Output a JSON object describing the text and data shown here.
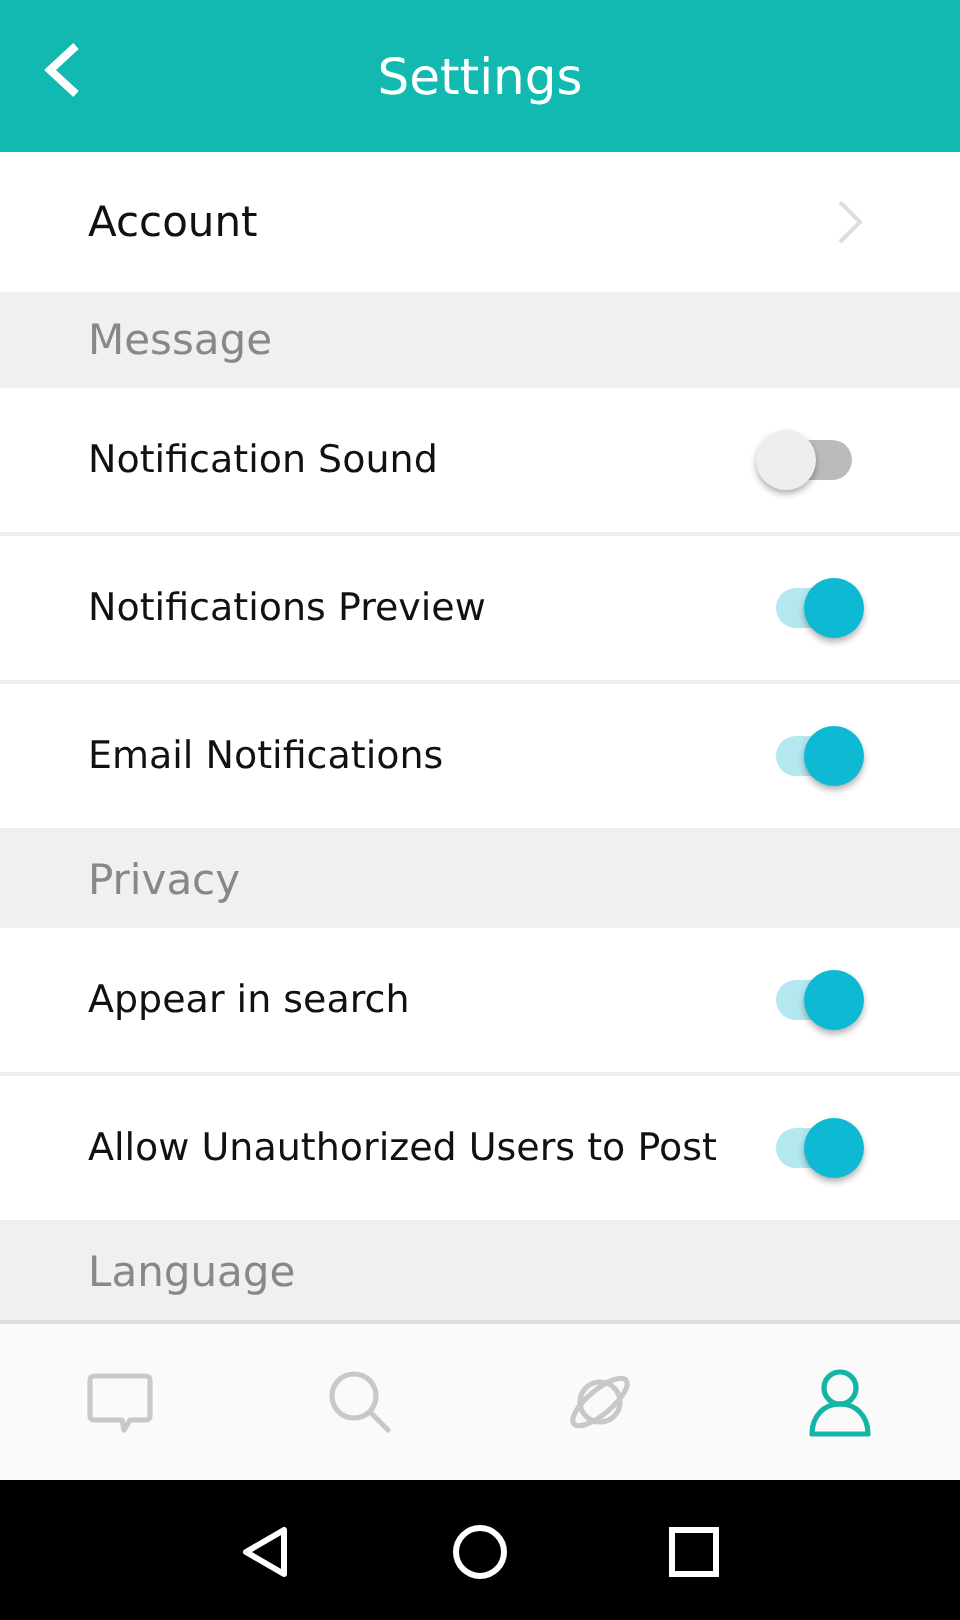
{
  "header": {
    "title": "Settings"
  },
  "items": [
    {
      "kind": "link",
      "label": "Account"
    },
    {
      "kind": "section",
      "label": "Message"
    },
    {
      "kind": "toggle",
      "label": "Notification Sound",
      "on": false
    },
    {
      "kind": "toggle",
      "label": "Notifications Preview",
      "on": true
    },
    {
      "kind": "toggle",
      "label": "Email Notifications",
      "on": true
    },
    {
      "kind": "section",
      "label": "Privacy"
    },
    {
      "kind": "toggle",
      "label": "Appear in search",
      "on": true
    },
    {
      "kind": "toggle",
      "label": "Allow Unauthorized Users to Post",
      "on": true
    },
    {
      "kind": "section",
      "label": "Language"
    }
  ],
  "tabs": [
    {
      "kind": "chat",
      "selected": false
    },
    {
      "kind": "search",
      "selected": false
    },
    {
      "kind": "planet",
      "selected": false
    },
    {
      "kind": "profile",
      "selected": true
    }
  ]
}
